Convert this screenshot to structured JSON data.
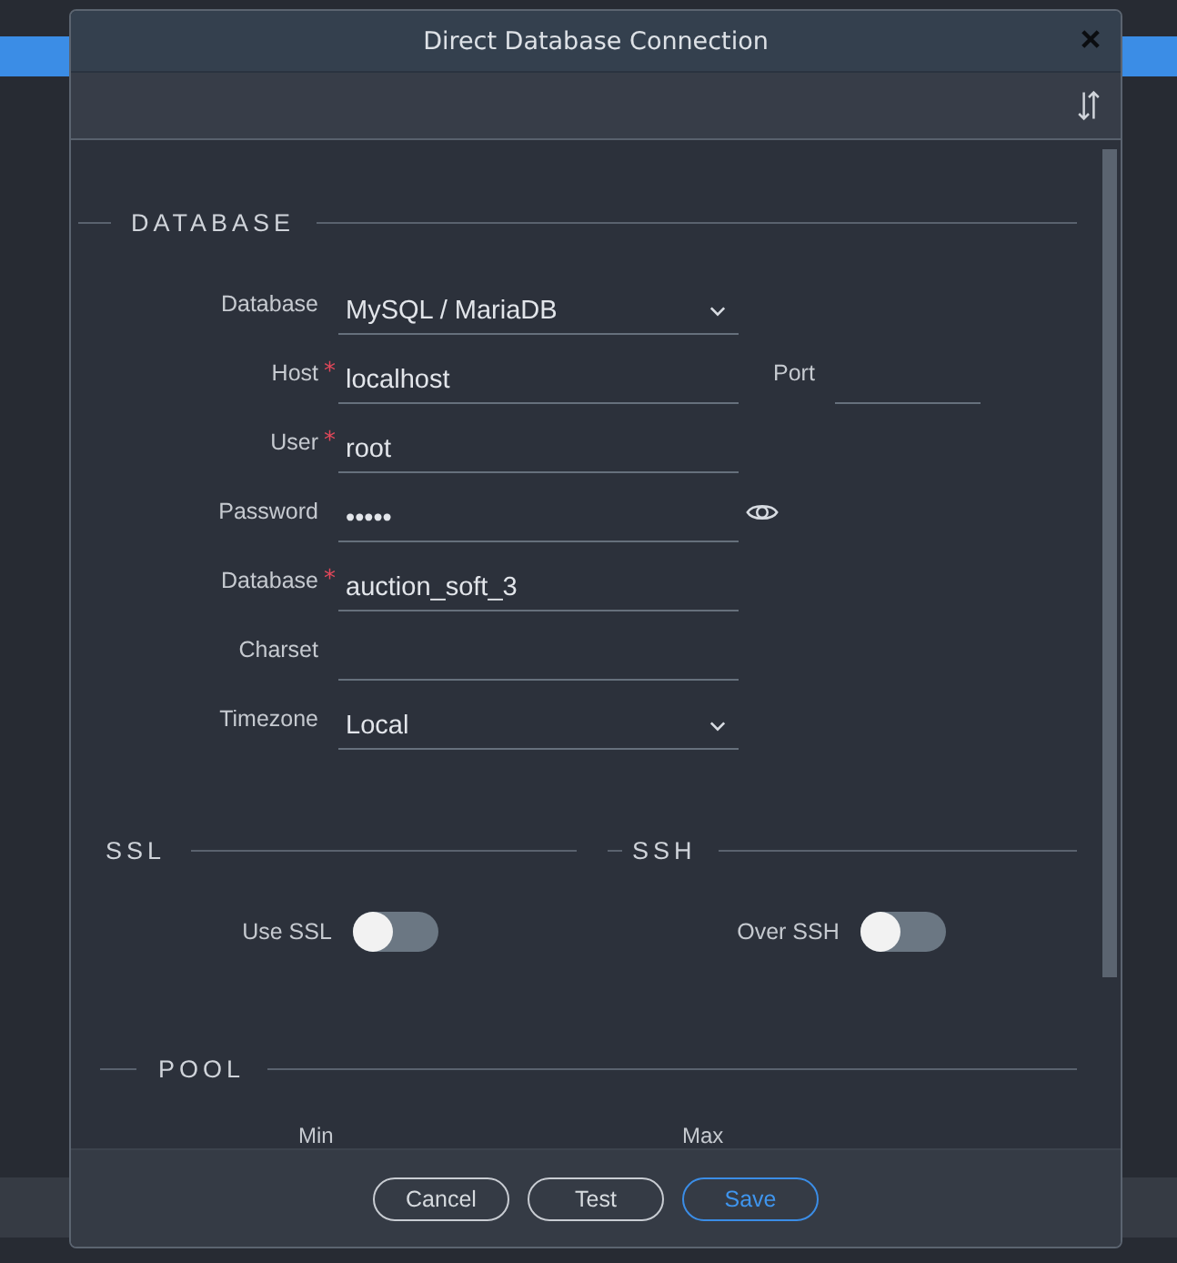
{
  "window": {
    "title": "Direct Database Connection"
  },
  "database": {
    "title": "DATABASE",
    "fields": [
      {
        "kind": "select",
        "label": "Database",
        "value": "MySQL / MariaDB"
      },
      {
        "kind": "text",
        "label": "Host",
        "required_mark": "*",
        "value": "localhost",
        "side": {
          "label": "Port"
        }
      },
      {
        "kind": "text",
        "label": "User",
        "required_mark": "*",
        "value": "root"
      },
      {
        "kind": "password",
        "label": "Password",
        "value": "•••••"
      },
      {
        "kind": "text",
        "label": "Database",
        "required_mark": "*",
        "value": "auction_soft_3"
      },
      {
        "kind": "text",
        "label": "Charset"
      },
      {
        "kind": "select",
        "label": "Timezone",
        "value": "Local"
      }
    ]
  },
  "ssl": {
    "title": "SSL",
    "toggle": {
      "label": "Use SSL",
      "on": false
    }
  },
  "ssh": {
    "title": "SSH",
    "toggle": {
      "label": "Over SSH",
      "on": false
    }
  },
  "pool": {
    "title": "POOL",
    "fields": [
      {
        "label": "Min"
      },
      {
        "label": "Max"
      }
    ]
  },
  "buttons": [
    {
      "label": "Cancel",
      "kind": "default"
    },
    {
      "label": "Test",
      "kind": "default"
    },
    {
      "label": "Save",
      "kind": "primary"
    }
  ]
}
